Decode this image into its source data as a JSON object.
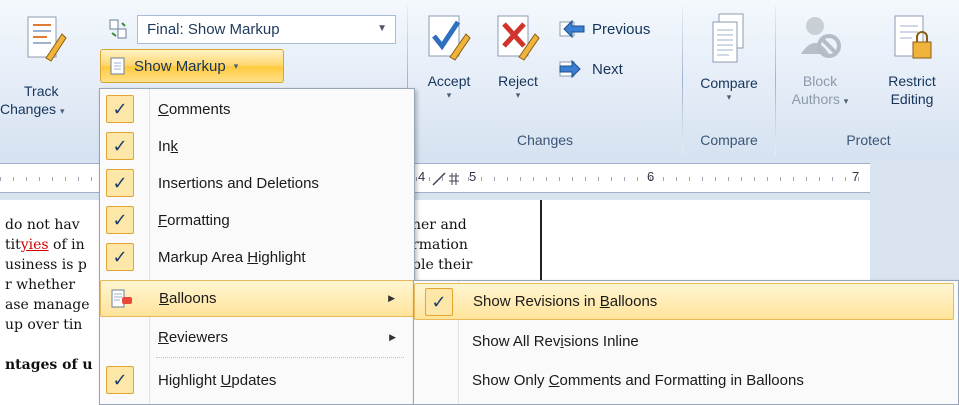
{
  "ribbon": {
    "track_changes": {
      "line1": "Track",
      "line2": "Changes",
      "arrow": "▾"
    },
    "display_for_review": {
      "value": "Final: Show Markup"
    },
    "show_markup_button": {
      "label": "Show Markup",
      "arrow": "▾"
    },
    "accept": {
      "label": "Accept",
      "arrow": "▾"
    },
    "reject": {
      "label": "Reject",
      "arrow": "▾"
    },
    "previous": {
      "label": "Previous"
    },
    "next": {
      "label": "Next"
    },
    "changes_group_label": "Changes",
    "compare": {
      "label": "Compare",
      "arrow": "▾"
    },
    "compare_group_label": "Compare",
    "block_authors": {
      "line1": "Block",
      "line2": "Authors",
      "arrow": "▾"
    },
    "restrict_editing": {
      "line1": "Restrict",
      "line2": "Editing"
    },
    "protect_group_label": "Protect"
  },
  "ruler": {
    "marks": [
      "4",
      "5",
      "6",
      "7"
    ]
  },
  "document": {
    "left_lines": [
      "do not hav",
      "tit",
      "yies",
      " of in",
      "usiness is p",
      "r whether",
      "ase manage",
      "up over tin",
      "",
      "ntages of u"
    ],
    "right_lines": [
      "her and",
      "rmation",
      "ble their"
    ]
  },
  "menu": {
    "items": [
      {
        "label": "Comments",
        "underline_index": 0,
        "checked": true
      },
      {
        "label": "Ink",
        "underline_index": 2,
        "checked": true
      },
      {
        "label": "Insertions and Deletions",
        "underline_index": -1,
        "checked": true
      },
      {
        "label": "Formatting",
        "underline_index": 0,
        "checked": true
      },
      {
        "label": "Markup Area Highlight",
        "underline_index": 12,
        "checked": true
      },
      {
        "label": "Balloons",
        "underline_index": 0,
        "checked": false,
        "submenu": true
      },
      {
        "label": "Reviewers",
        "underline_index": 0,
        "checked": false,
        "submenu": true
      },
      {
        "label": "Highlight Updates",
        "underline_index": 10,
        "checked": true
      }
    ],
    "submenu_arrow": "▶",
    "check_glyph": "✓"
  },
  "balloons_submenu": {
    "items": [
      {
        "label": "Show Revisions in Balloons",
        "checked": true
      },
      {
        "label": "Show All Revisions Inline",
        "checked": false
      },
      {
        "label": "Show Only Comments and Formatting in Balloons",
        "checked": false
      }
    ]
  },
  "colors": {
    "highlight": "#ffe39a",
    "check_bg": "#fde7a8",
    "ribbon_text": "#15345a"
  }
}
